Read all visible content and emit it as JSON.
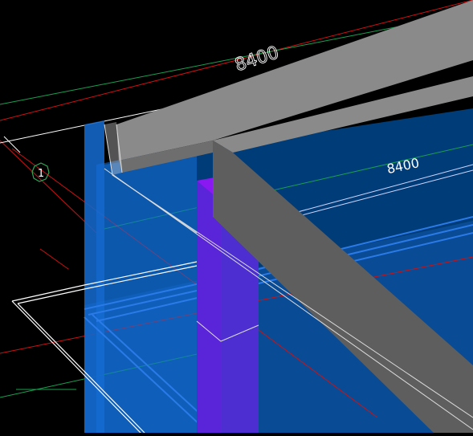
{
  "viewport": {
    "background": "#000000",
    "dimension_top": "8400",
    "dimension_right": "8400",
    "grid_bubble_label": "1"
  },
  "colors": {
    "grid_red": "#d01010",
    "grid_green": "#18a050",
    "dim_white": "#ffffff",
    "wall_blue": "#1466c8",
    "slab_blue": "#003c78",
    "beam_gray": "#8a8a8a",
    "beam_dark": "#5e5e5e",
    "column_purple": "#5a24d8",
    "bubble_green": "#2eaa55"
  }
}
